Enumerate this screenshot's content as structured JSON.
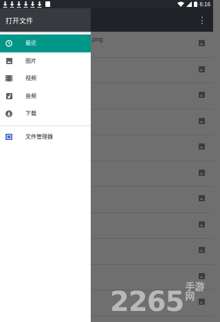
{
  "status_bar": {
    "time": "6:16",
    "icons": [
      "download-icon",
      "download-icon",
      "download-icon",
      "download-icon",
      "download-icon",
      "download-icon",
      "sd-card-icon",
      "wifi-icon",
      "signal-icon",
      "battery-icon"
    ]
  },
  "drawer": {
    "title": "打开文件",
    "items": [
      {
        "label": "最近",
        "icon": "clock-icon",
        "active": true
      },
      {
        "label": "图片",
        "icon": "image-icon",
        "active": false
      },
      {
        "label": "视频",
        "icon": "video-icon",
        "active": false
      },
      {
        "label": "音频",
        "icon": "audio-icon",
        "active": false
      },
      {
        "label": "下载",
        "icon": "download-circle-icon",
        "active": false
      }
    ],
    "extra_items": [
      {
        "label": "文件管理器",
        "icon": "file-manager-icon"
      }
    ]
  },
  "file_list": {
    "first_file_name_fragment": ".png",
    "row_count": 11
  },
  "watermark": {
    "number": "2265",
    "text": "手游网"
  },
  "colors": {
    "accent": "#009688",
    "drawer_header": "#373b3f",
    "status_bar": "#23272b",
    "file_manager_icon": "#3f66c9"
  }
}
